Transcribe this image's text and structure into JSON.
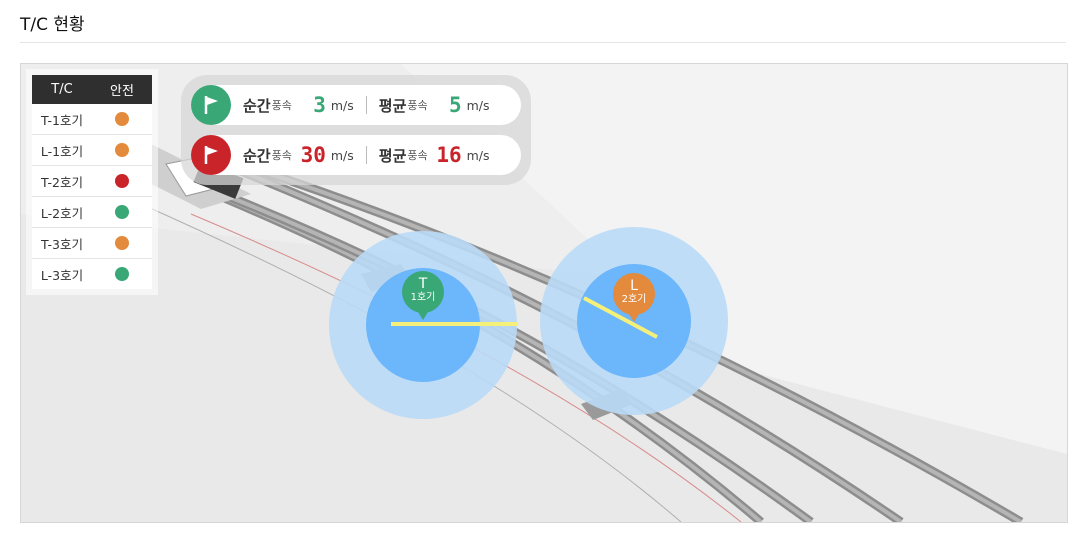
{
  "page": {
    "title": "T/C 현황"
  },
  "table": {
    "headers": {
      "tc": "T/C",
      "safety": "안전"
    },
    "rows": [
      {
        "name": "T-1호기",
        "status": "orange"
      },
      {
        "name": "L-1호기",
        "status": "orange"
      },
      {
        "name": "T-2호기",
        "status": "red"
      },
      {
        "name": "L-2호기",
        "status": "green"
      },
      {
        "name": "T-3호기",
        "status": "orange"
      },
      {
        "name": "L-3호기",
        "status": "green"
      }
    ]
  },
  "status_colors": {
    "green": "#3aa776",
    "orange": "#e38a3c",
    "red": "#c8242a"
  },
  "wind": {
    "safe": {
      "instant_label": "순간",
      "instant_sub": "풍속",
      "instant_value": "3",
      "instant_unit": "m/s",
      "avg_label": "평균",
      "avg_sub": "풍속",
      "avg_value": "5",
      "avg_unit": "m/s",
      "color": "#3aa776",
      "icon": "flag-icon"
    },
    "danger": {
      "instant_label": "순간",
      "instant_sub": "풍속",
      "instant_value": "30",
      "instant_unit": "m/s",
      "avg_label": "평균",
      "avg_sub": "풍속",
      "avg_value": "16",
      "avg_unit": "m/s",
      "color": "#c8242a",
      "icon": "flag-icon"
    }
  },
  "cranes": [
    {
      "letter": "T",
      "name": "1호기",
      "color": "#3aa776"
    },
    {
      "letter": "L",
      "name": "2호기",
      "color": "#e38a3c"
    }
  ],
  "map": {
    "circle_outer": "#b9daf7",
    "circle_inner": "#6cb6fb",
    "jib": "#f4f07a"
  }
}
